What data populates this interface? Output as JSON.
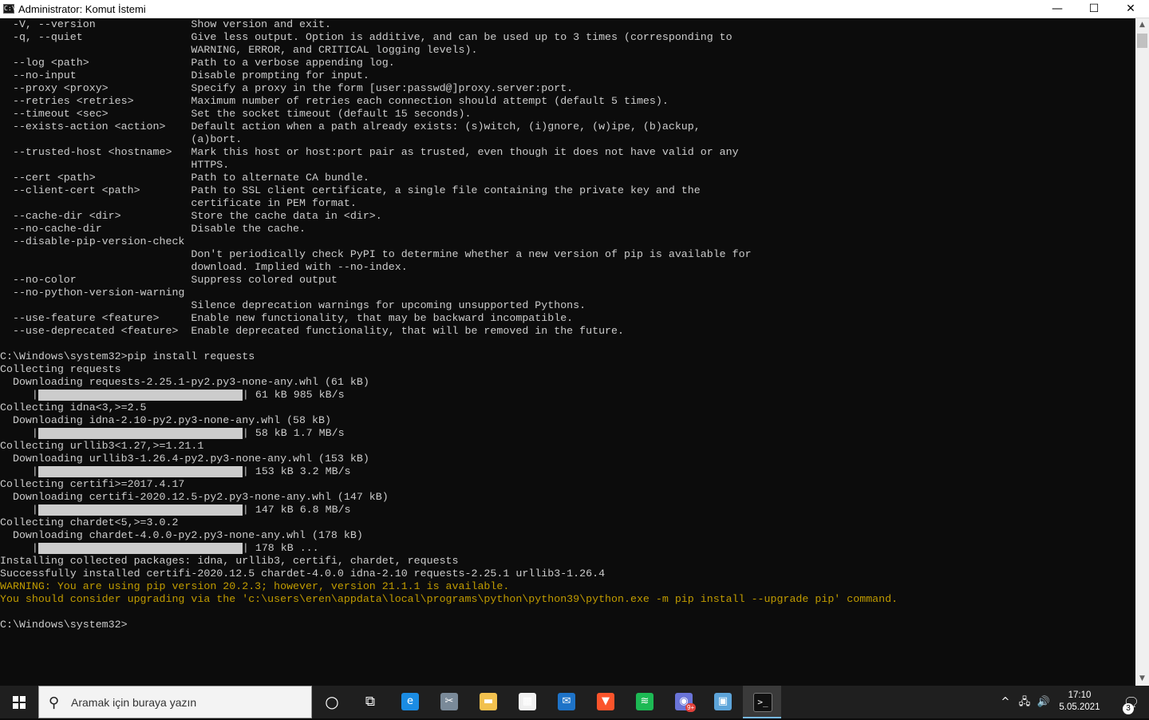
{
  "window": {
    "title": "Administrator: Komut İstemi",
    "app_icon_text": "C:\\",
    "controls": {
      "minimize": "—",
      "maximize": "☐",
      "close": "✕"
    }
  },
  "console": {
    "text_color": "#cccccc",
    "warning_color": "#c19c00",
    "lines": [
      {
        "text": "  -V, --version               Show version and exit."
      },
      {
        "text": "  -q, --quiet                 Give less output. Option is additive, and can be used up to 3 times (corresponding to"
      },
      {
        "text": "                              WARNING, ERROR, and CRITICAL logging levels)."
      },
      {
        "text": "  --log <path>                Path to a verbose appending log."
      },
      {
        "text": "  --no-input                  Disable prompting for input."
      },
      {
        "text": "  --proxy <proxy>             Specify a proxy in the form [user:passwd@]proxy.server:port."
      },
      {
        "text": "  --retries <retries>         Maximum number of retries each connection should attempt (default 5 times)."
      },
      {
        "text": "  --timeout <sec>             Set the socket timeout (default 15 seconds)."
      },
      {
        "text": "  --exists-action <action>    Default action when a path already exists: (s)witch, (i)gnore, (w)ipe, (b)ackup,"
      },
      {
        "text": "                              (a)bort."
      },
      {
        "text": "  --trusted-host <hostname>   Mark this host or host:port pair as trusted, even though it does not have valid or any"
      },
      {
        "text": "                              HTTPS."
      },
      {
        "text": "  --cert <path>               Path to alternate CA bundle."
      },
      {
        "text": "  --client-cert <path>        Path to SSL client certificate, a single file containing the private key and the"
      },
      {
        "text": "                              certificate in PEM format."
      },
      {
        "text": "  --cache-dir <dir>           Store the cache data in <dir>."
      },
      {
        "text": "  --no-cache-dir              Disable the cache."
      },
      {
        "text": "  --disable-pip-version-check"
      },
      {
        "text": "                              Don't periodically check PyPI to determine whether a new version of pip is available for"
      },
      {
        "text": "                              download. Implied with --no-index."
      },
      {
        "text": "  --no-color                  Suppress colored output"
      },
      {
        "text": "  --no-python-version-warning"
      },
      {
        "text": "                              Silence deprecation warnings for upcoming unsupported Pythons."
      },
      {
        "text": "  --use-feature <feature>     Enable new functionality, that may be backward incompatible."
      },
      {
        "text": "  --use-deprecated <feature>  Enable deprecated functionality, that will be removed in the future."
      },
      {
        "text": ""
      },
      {
        "text": "C:\\Windows\\system32>pip install requests"
      },
      {
        "text": "Collecting requests"
      },
      {
        "text": "  Downloading requests-2.25.1-py2.py3-none-any.whl (61 kB)"
      },
      {
        "text": "     |",
        "progress": 1,
        "suffix": "| 61 kB 985 kB/s"
      },
      {
        "text": "Collecting idna<3,>=2.5"
      },
      {
        "text": "  Downloading idna-2.10-py2.py3-none-any.whl (58 kB)"
      },
      {
        "text": "     |",
        "progress": 1,
        "suffix": "| 58 kB 1.7 MB/s"
      },
      {
        "text": "Collecting urllib3<1.27,>=1.21.1"
      },
      {
        "text": "  Downloading urllib3-1.26.4-py2.py3-none-any.whl (153 kB)"
      },
      {
        "text": "     |",
        "progress": 1,
        "suffix": "| 153 kB 3.2 MB/s"
      },
      {
        "text": "Collecting certifi>=2017.4.17"
      },
      {
        "text": "  Downloading certifi-2020.12.5-py2.py3-none-any.whl (147 kB)"
      },
      {
        "text": "     |",
        "progress": 1,
        "suffix": "| 147 kB 6.8 MB/s"
      },
      {
        "text": "Collecting chardet<5,>=3.0.2"
      },
      {
        "text": "  Downloading chardet-4.0.0-py2.py3-none-any.whl (178 kB)"
      },
      {
        "text": "     |",
        "progress": 1,
        "suffix": "| 178 kB ..."
      },
      {
        "text": "Installing collected packages: idna, urllib3, certifi, chardet, requests"
      },
      {
        "text": "Successfully installed certifi-2020.12.5 chardet-4.0.0 idna-2.10 requests-2.25.1 urllib3-1.26.4"
      },
      {
        "text": "WARNING: You are using pip version 20.2.3; however, version 21.1.1 is available.",
        "warn": true
      },
      {
        "text": "You should consider upgrading via the 'c:\\users\\eren\\appdata\\local\\programs\\python\\python39\\python.exe -m pip install --upgrade pip' command.",
        "warn": true
      },
      {
        "text": ""
      },
      {
        "text": "C:\\Windows\\system32>"
      }
    ]
  },
  "scrollbar": {
    "up_glyph": "▲",
    "down_glyph": "▼"
  },
  "taskbar": {
    "search_placeholder": "Aramak için buraya yazın",
    "search_glyph": "⚲",
    "cortana_glyph": "○",
    "taskview_glyph": "⧉",
    "apps": [
      {
        "name": "edge-icon",
        "glyph": "e",
        "color": "#1b8ce3"
      },
      {
        "name": "snipping-tool-icon",
        "glyph": "✂",
        "color": "#7a8a99"
      },
      {
        "name": "file-explorer-icon",
        "glyph": "▬",
        "color": "#f2c14e"
      },
      {
        "name": "store-icon",
        "glyph": "▦",
        "color": "#f0f0f0"
      },
      {
        "name": "mail-icon",
        "glyph": "✉",
        "color": "#1e73c8"
      },
      {
        "name": "brave-icon",
        "glyph": "▼",
        "color": "#fb542b"
      },
      {
        "name": "spotify-icon",
        "glyph": "≋",
        "color": "#1db954"
      },
      {
        "name": "discord-icon",
        "glyph": "◉",
        "color": "#6a74d8"
      },
      {
        "name": "control-panel-icon",
        "glyph": "▣",
        "color": "#5da4d9"
      },
      {
        "name": "command-prompt-icon",
        "glyph": ">_",
        "color": "#111111"
      }
    ],
    "discord_badge": "9+",
    "tray": {
      "chevron_glyph": "^",
      "network_glyph": "🖧",
      "volume_glyph": "🔊",
      "time": "17:10",
      "date": "5.05.2021",
      "notification_glyph": "🗨",
      "notification_count": "3"
    }
  }
}
